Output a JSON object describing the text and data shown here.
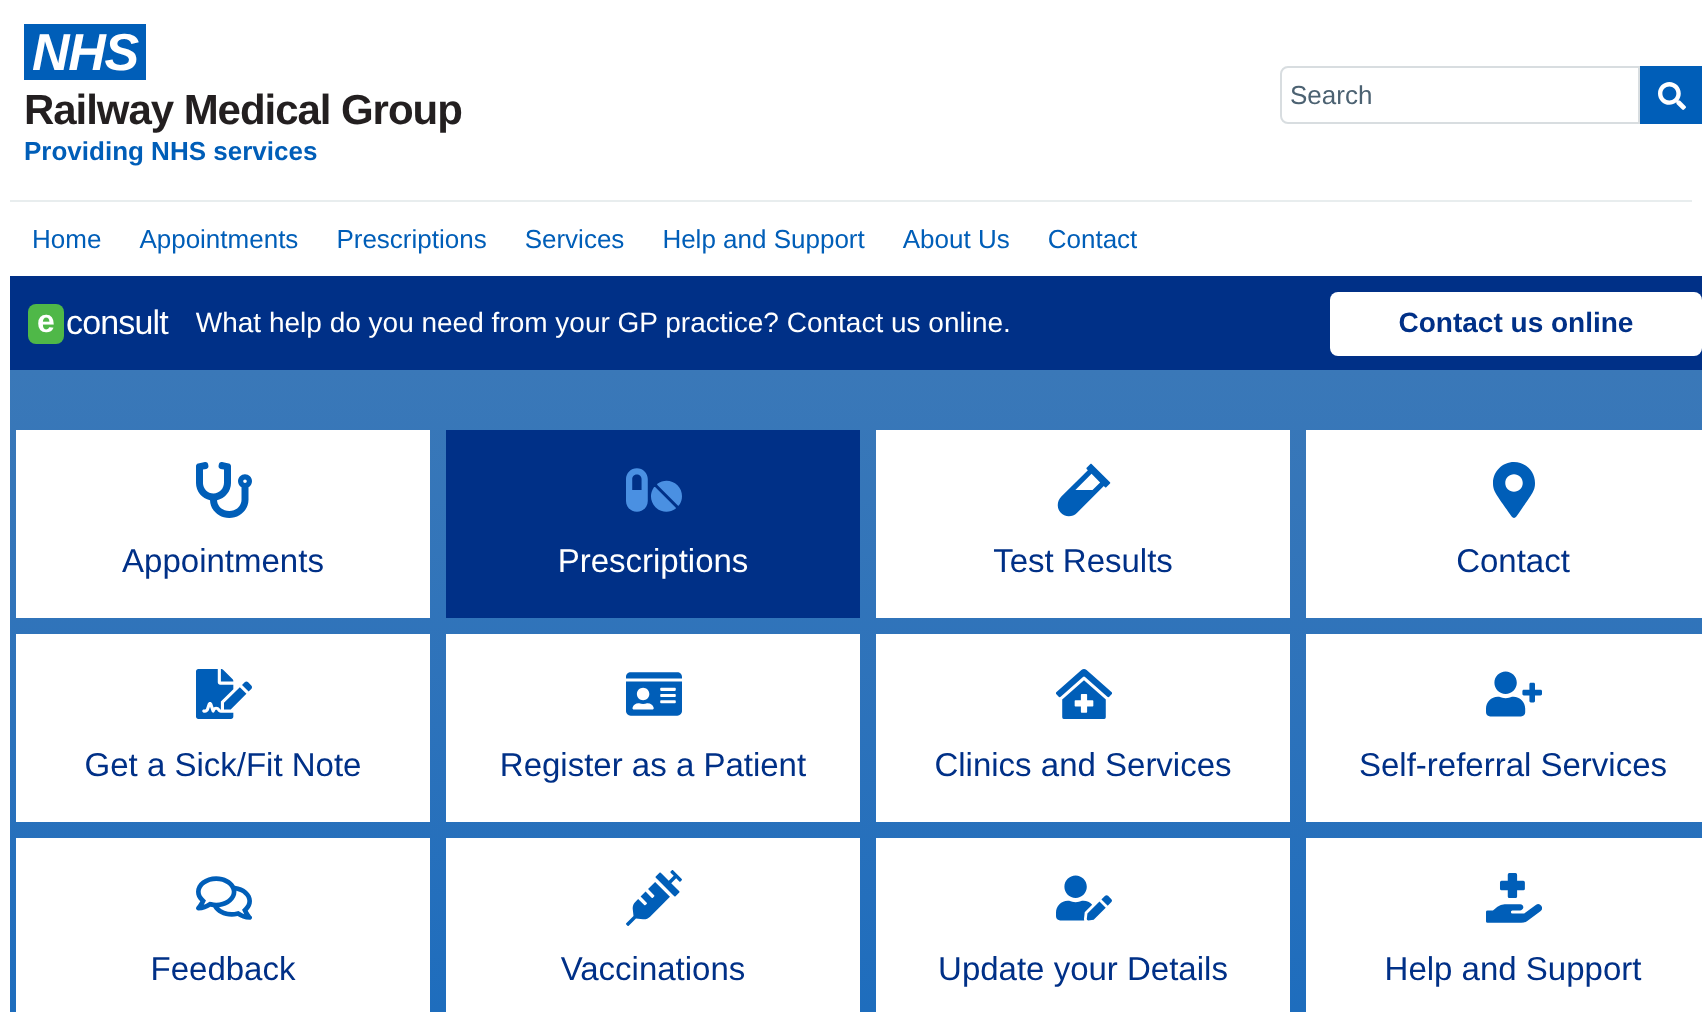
{
  "header": {
    "logo": "NHS",
    "practice_name": "Railway Medical Group",
    "tagline": "Providing NHS services",
    "search": {
      "placeholder": "Search"
    }
  },
  "nav": [
    "Home",
    "Appointments",
    "Prescriptions",
    "Services",
    "Help and Support",
    "About Us",
    "Contact"
  ],
  "econsult_banner": {
    "logo_letter": "e",
    "logo_word": "consult",
    "message": "What help do you need from your GP practice? Contact us online.",
    "button": "Contact us online"
  },
  "tiles": [
    {
      "label": "Appointments",
      "selected": false
    },
    {
      "label": "Prescriptions",
      "selected": true
    },
    {
      "label": "Test Results",
      "selected": false
    },
    {
      "label": "Contact",
      "selected": false
    },
    {
      "label": "Get a Sick/Fit Note",
      "selected": false
    },
    {
      "label": "Register as a Patient",
      "selected": false
    },
    {
      "label": "Clinics and Services",
      "selected": false
    },
    {
      "label": "Self-referral Services",
      "selected": false
    },
    {
      "label": "Feedback",
      "selected": false
    },
    {
      "label": "Vaccinations",
      "selected": false
    },
    {
      "label": "Update your Details",
      "selected": false
    },
    {
      "label": "Help and Support",
      "selected": false
    }
  ]
}
